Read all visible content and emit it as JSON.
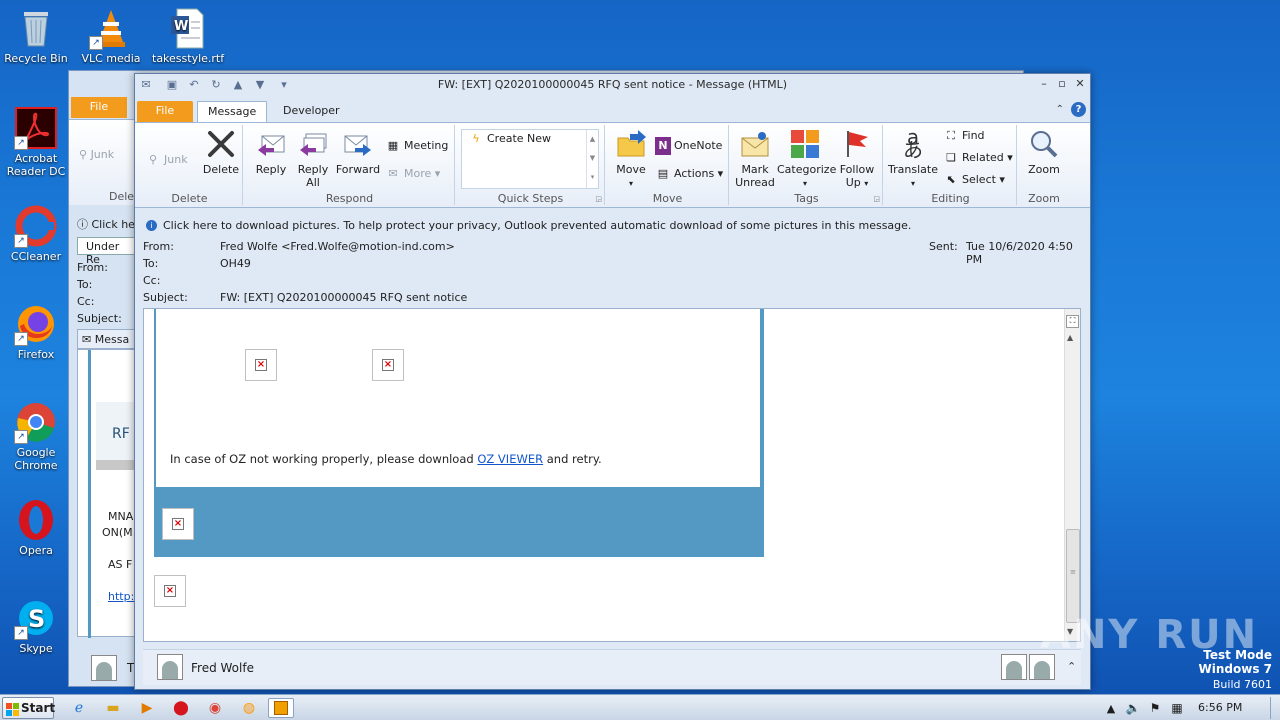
{
  "desktop": {
    "icons": [
      {
        "label": "Recycle Bin"
      },
      {
        "label": "VLC media"
      },
      {
        "label": "takesstyle.rtf"
      },
      {
        "label": "Acrobat Reader DC"
      },
      {
        "label": "CCleaner"
      },
      {
        "label": "Firefox"
      },
      {
        "label": "Google Chrome"
      },
      {
        "label": "Opera"
      },
      {
        "label": "Skype"
      }
    ]
  },
  "back_window": {
    "file_tab": "File",
    "junk": "Junk",
    "delete_group": "Delet",
    "click_here": "Click he",
    "dropdown": "Under Re",
    "from": "From:",
    "to": "To:",
    "cc": "Cc:",
    "subject": "Subject:",
    "message_tab": "Messa",
    "body_rf": "RF",
    "body_mna": "MNA",
    "body_on": "ON(M",
    "body_as": "AS F",
    "body_http": "http:/",
    "people_initial": "T"
  },
  "window": {
    "title": "FW: [EXT] Q2020100000045 RFQ sent notice  -  Message (HTML)",
    "tabs": [
      "File",
      "Message",
      "Developer"
    ]
  },
  "ribbon": {
    "delete_group": {
      "label": "Delete",
      "junk": "Junk",
      "delete": "Delete"
    },
    "respond_group": {
      "label": "Respond",
      "reply": "Reply",
      "reply_all_1": "Reply",
      "reply_all_2": "All",
      "forward": "Forward",
      "meeting": "Meeting",
      "more": "More"
    },
    "quick_steps_group": {
      "label": "Quick Steps",
      "create_new": "Create New"
    },
    "move_group": {
      "label": "Move",
      "move": "Move",
      "onenote": "OneNote",
      "actions": "Actions"
    },
    "tags_group": {
      "label": "Tags",
      "mark_unread_1": "Mark",
      "mark_unread_2": "Unread",
      "categorize": "Categorize",
      "follow_up_1": "Follow",
      "follow_up_2": "Up"
    },
    "editing_group": {
      "label": "Editing",
      "translate": "Translate",
      "find": "Find",
      "related": "Related",
      "select": "Select"
    },
    "zoom_group": {
      "label": "Zoom",
      "zoom": "Zoom"
    }
  },
  "infobar": "Click here to download pictures. To help protect your privacy, Outlook prevented automatic download of some pictures in this message.",
  "header": {
    "from_label": "From:",
    "from_value": "Fred Wolfe <Fred.Wolfe@motion-ind.com>",
    "to_label": "To:",
    "to_value": "OH49",
    "cc_label": "Cc:",
    "subject_label": "Subject:",
    "subject_value": "FW: [EXT] Q2020100000045 RFQ sent notice",
    "sent_label": "Sent:",
    "sent_value": "Tue 10/6/2020 4:50 PM"
  },
  "body": {
    "line_before": "In case of OZ not working properly, please download ",
    "link": "OZ VIEWER",
    "line_after": " and retry."
  },
  "people_pane": {
    "name": "Fred Wolfe"
  },
  "taskbar": {
    "start": "Start",
    "clock": "6:56 PM"
  },
  "watermark": {
    "line1": "Test Mode",
    "line2": "Windows 7",
    "line3": "Build 7601",
    "brand": "ANY RUN"
  },
  "colors": {
    "accent_file": "#f29b1c",
    "banner_blue": "#5399c4",
    "link": "#1155cc"
  }
}
